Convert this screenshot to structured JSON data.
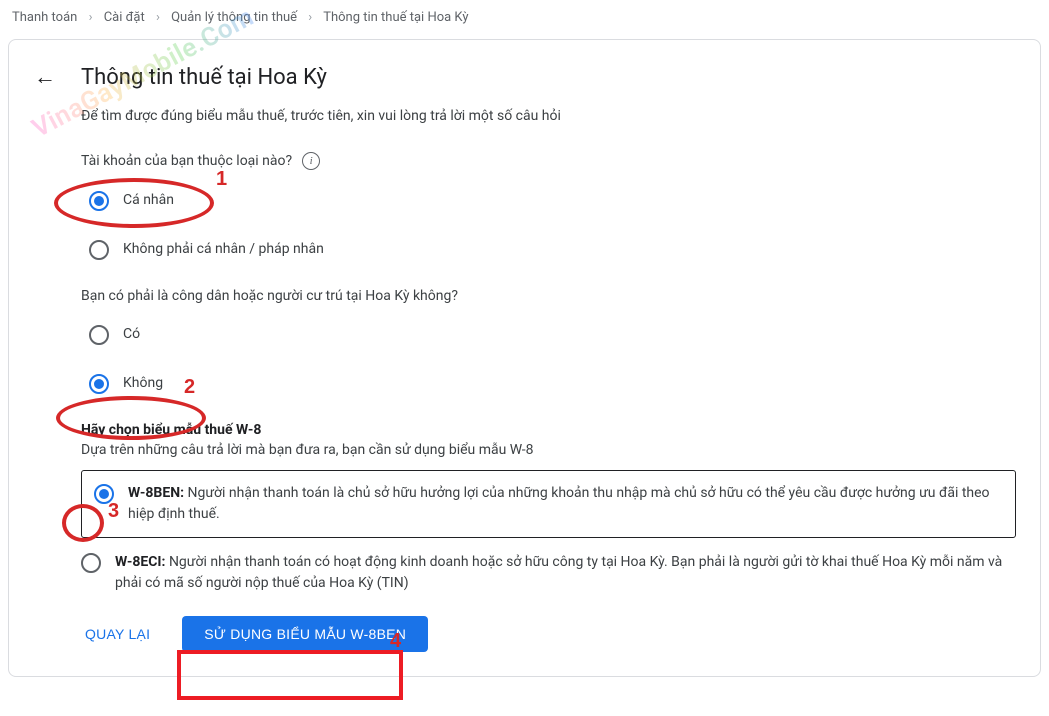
{
  "breadcrumb": [
    "Thanh toán",
    "Cài đặt",
    "Quản lý thông tin thuế",
    "Thông tin thuế tại Hoa Kỳ"
  ],
  "page_title": "Thông tin thuế tại Hoa Kỳ",
  "intro": "Để tìm được đúng biểu mẫu thuế, trước tiên, xin vui lòng trả lời một số câu hỏi",
  "q1": {
    "label": "Tài khoản của bạn thuộc loại nào?",
    "opt_individual": "Cá nhân",
    "opt_non_individual": "Không phải cá nhân / pháp nhân",
    "selected": "individual"
  },
  "q2": {
    "label": "Bạn có phải là công dân hoặc người cư trú tại Hoa Kỳ không?",
    "opt_yes": "Có",
    "opt_no": "Không",
    "selected": "no"
  },
  "w8": {
    "heading": "Hãy chọn biểu mẫu thuế W-8",
    "subdesc": "Dựa trên những câu trả lời mà bạn đưa ra, bạn cần sử dụng biểu mẫu W-8",
    "ben_title": "W-8BEN:",
    "ben_desc": " Người nhận thanh toán là chủ sở hữu hưởng lợi của những khoản thu nhập mà chủ sở hữu có thể yêu cầu được hưởng ưu đãi theo hiệp định thuế.",
    "eci_title": "W-8ECI:",
    "eci_desc": " Người nhận thanh toán có hoạt động kinh doanh hoặc sở hữu công ty tại Hoa Kỳ. Bạn phải là người gửi tờ khai thuế Hoa Kỳ mỗi năm và phải có mã số người nộp thuế của Hoa Kỳ (TIN)",
    "selected": "ben"
  },
  "actions": {
    "back": "QUAY LẠI",
    "use_form": "SỬ DỤNG BIỂU MẪU W-8BEN"
  },
  "annotations": {
    "n1": "1",
    "n2": "2",
    "n3": "3",
    "n4": "4"
  },
  "watermark": "VinaGayMobile.Com"
}
